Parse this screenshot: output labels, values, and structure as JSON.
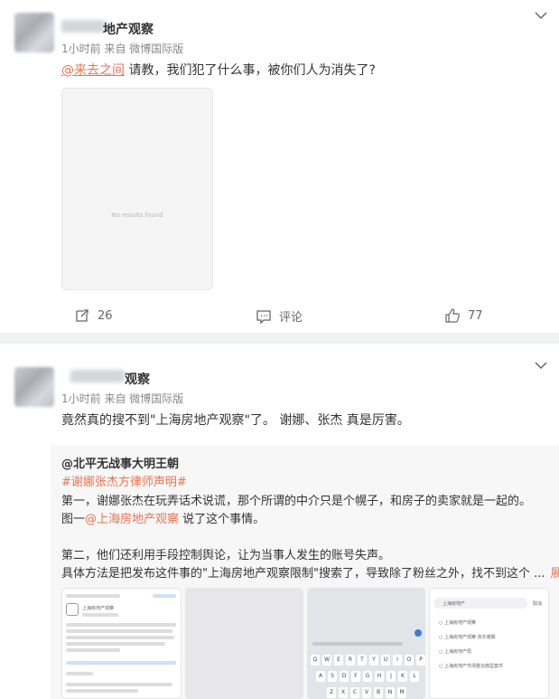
{
  "post1": {
    "name_suffix": "地产观察",
    "meta": "1小时前 来自 微博国际版",
    "mention": "@来去之间",
    "text": " 请教，我们犯了什么事，被你们人为消失了?",
    "image_placeholder": "No results found",
    "repost_count": "26",
    "comment_label": "评论",
    "like_count": "77"
  },
  "post2": {
    "name_suffix": "观察",
    "meta": "1小时前 来自 微博国际版",
    "text": "竟然真的搜不到\"上海房地产观察\"了。 谢娜、张杰 真是厉害。"
  },
  "retweet": {
    "author": "@北平无战事大明王朝",
    "hashtag": "#谢娜张杰方律师声明#",
    "line1": "第一，谢娜张杰在玩弄话术说谎，那个所谓的中介只是个幌子，和房子的卖家就是一起的。",
    "line2_prefix": "图一",
    "line2_mention": "@上海房地产观察",
    "line2_suffix": " 说了这个事情。",
    "line3": "第二，他们还利用手段控制舆论，让为当事人发生的账号失声。",
    "line4": "具体方法是把发布这件事的\"上海房地产观察限制\"搜索了，导致除了粉丝之外，找不到这个 ...",
    "more_label": "展开"
  },
  "thumbs": {
    "t1_title": "上海房地产观察",
    "t4_search": "上海房地产",
    "t4_cancel": "取消",
    "t4_items": [
      "上海房地产观察",
      "上海房地产观察 张杰谢娜",
      "上海房地产局",
      "上海房地产市场整治典型案件"
    ],
    "kbd_row1": [
      "Q",
      "W",
      "E",
      "R",
      "T",
      "Y",
      "U",
      "I",
      "O",
      "P"
    ],
    "kbd_row2": [
      "A",
      "S",
      "D",
      "F",
      "G",
      "H",
      "J",
      "K",
      "L"
    ],
    "kbd_row3": [
      "Z",
      "X",
      "C",
      "V",
      "B",
      "N",
      "M"
    ]
  }
}
